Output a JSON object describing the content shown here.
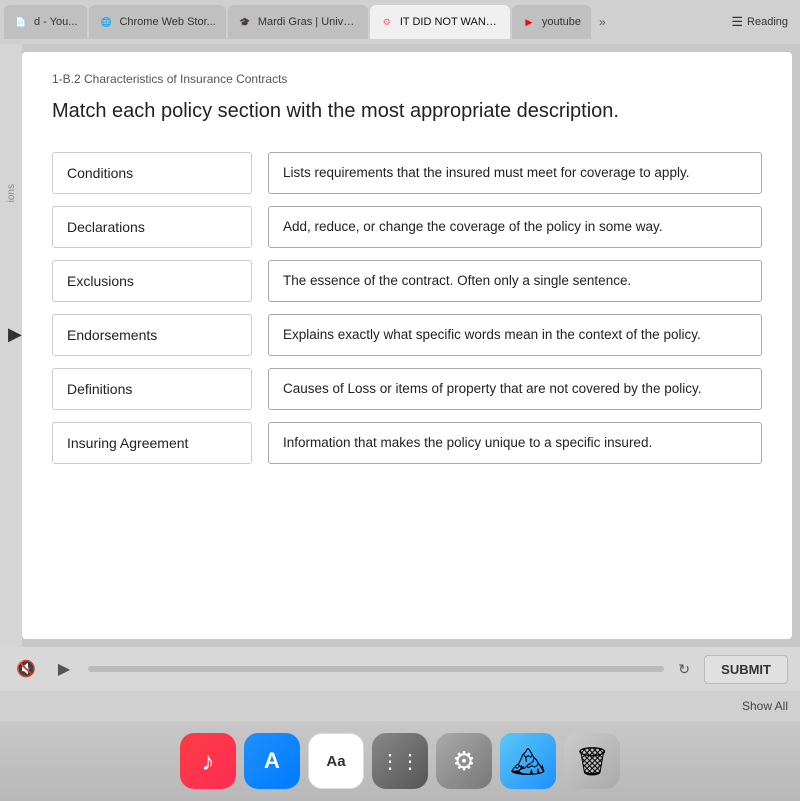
{
  "tabBar": {
    "tabs": [
      {
        "id": "tab1",
        "label": "d - You...",
        "favicon": "📄",
        "active": false
      },
      {
        "id": "tab2",
        "label": "Chrome Web Stor...",
        "favicon": "🌐",
        "active": false
      },
      {
        "id": "tab3",
        "label": "Mardi Gras | Unive...",
        "favicon": "🎓",
        "active": false
      },
      {
        "id": "tab4",
        "label": "IT DID NOT WANT...",
        "favicon": "⚙",
        "active": true
      },
      {
        "id": "tab5",
        "label": "youtube",
        "favicon": "▶",
        "active": false
      }
    ],
    "more": "»",
    "readingList": "Reading"
  },
  "lesson": {
    "code": "1-B.2 Characteristics of Insurance Contracts",
    "question": "Match each policy section with the most appropriate description.",
    "items": [
      {
        "term": "Conditions",
        "description": "Lists requirements that the insured must meet for coverage to apply."
      },
      {
        "term": "Declarations",
        "description": "Add, reduce, or change the coverage of the policy in some way."
      },
      {
        "term": "Exclusions",
        "description": "The essence of the contract. Often only a single sentence."
      },
      {
        "term": "Endorsements",
        "description": "Explains exactly what specific words mean in the context of the policy."
      },
      {
        "term": "Definitions",
        "description": "Causes of Loss or items of property that are not covered by the policy."
      },
      {
        "term": "Insuring Agreement",
        "description": "Information that makes the policy unique to a specific insured."
      }
    ]
  },
  "sidebar": {
    "label": "ions"
  },
  "toolbar": {
    "submitLabel": "SUBMIT"
  },
  "showAllBar": {
    "label": "Show All"
  },
  "dock": {
    "icons": [
      {
        "name": "music",
        "emoji": "♪",
        "class": "music"
      },
      {
        "name": "app-store",
        "emoji": "A",
        "class": "appstore"
      },
      {
        "name": "dictionary",
        "emoji": "Aa",
        "class": "dictionary"
      },
      {
        "name": "launchpad",
        "emoji": "⋮⋮",
        "class": "launchpad"
      },
      {
        "name": "system-prefs",
        "emoji": "⚙",
        "class": "system-prefs"
      },
      {
        "name": "finder-like",
        "emoji": "🏔",
        "class": "finder-like"
      },
      {
        "name": "trash",
        "emoji": "🗑",
        "class": "trash"
      }
    ]
  }
}
